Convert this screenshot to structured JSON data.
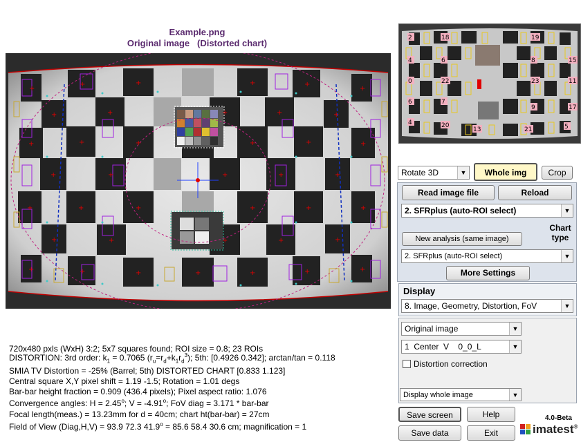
{
  "header": {
    "filename": "Example.png",
    "subtitle": "Original image   (Distorted chart)"
  },
  "controls": {
    "rotate_select": "Rotate 3D",
    "whole_img": "Whole img",
    "crop": "Crop",
    "read_image": "Read image file",
    "reload": "Reload",
    "module_select": "2. SFRplus (auto-ROI select)",
    "chart_type_label": "Chart type",
    "new_analysis": "New analysis (same image)",
    "chart_type_select": "2. SFRplus (auto-ROI select)",
    "more_settings": "More Settings",
    "display_label": "Display",
    "display_select": "8.  Image, Geometry, Distortion, FoV",
    "image_select": "Original image",
    "center_select": "1  Center  V    0_0_L",
    "distortion_checkbox": "Distortion correction",
    "display_mode_select": "Display whole image",
    "save_screen": "Save screen",
    "help": "Help",
    "save_data": "Save data",
    "exit": "Exit",
    "version": "4.0-Beta",
    "brand": "imatest",
    "brand_mark": "®"
  },
  "thumb_labels": [
    "2",
    "18",
    "19",
    "4",
    "6",
    "8",
    "15",
    "0",
    "22",
    "23",
    "11",
    "6",
    "7",
    "9",
    "17",
    "4",
    "20",
    "13",
    "21",
    "5"
  ],
  "results": {
    "line1": "720x480 pxls (WxH) 3:2;   5x7 squares found;   ROI size = 0.8;   23 ROIs",
    "line2a": "DISTORTION:  3rd order:  k",
    "line2_k1_sub": "1",
    "line2b": " = 0.7065  (r",
    "line2_u_sub": "u",
    "line2c": "=r",
    "line2_d_sub": "d",
    "line2d": "+k",
    "line2_k1b_sub": "1",
    "line2e": "r",
    "line2_d2_sub": "d",
    "line2_3_sup": "3",
    "line2f": ");   5th: [0.4926  0.342];   arctan/tan = 0.118",
    "line3": "SMIA TV Distortion = -25%  (Barrel; 5th)    DISTORTED CHART [0.833 1.123]",
    "line4": "Central square X,Y pixel shift = 1.19  -1.5;    Rotation = 1.01 degs",
    "line5": "Bar-bar height fraction = 0.909  (436.4 pixels);  Pixel aspect ratio: 1.076",
    "line6a": "Convergence angles:  H = 2.45",
    "line6_deg1": "o",
    "line6b": ";  V = -4.91",
    "line6_deg2": "o",
    "line6c": ";   FoV diag = 3.171 * bar-bar",
    "line7": "Focal length(meas.) = 13.23mm  for d = 40cm;  chart ht(bar-bar) = 27cm",
    "line8a": "Field of View (Diag,H,V) = 93.9  72.3  41.9",
    "line8_deg": "o",
    "line8b": " = 85.6  58.4  30.6 cm;  magnification = 1"
  },
  "colors": {
    "title": "#5a2a6e",
    "panel": "#dde3ec",
    "whole_img_bg": "#fff8c8"
  }
}
